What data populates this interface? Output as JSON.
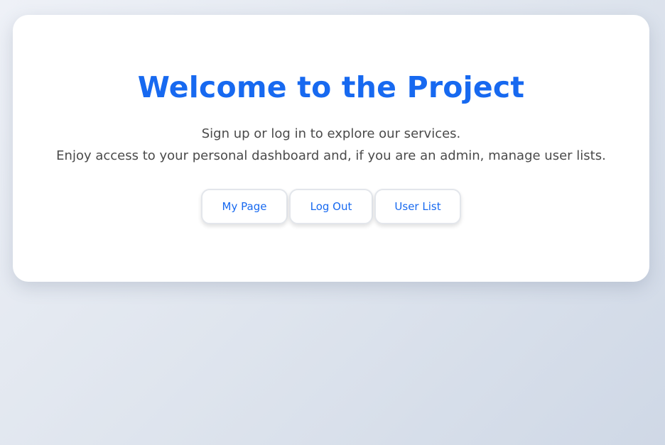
{
  "hero": {
    "title": "Welcome to the Project",
    "description_line1": "Sign up or log in to explore our services.",
    "description_line2": "Enjoy access to your personal dashboard and, if you are an admin, manage user lists."
  },
  "actions": {
    "my_page_label": "My Page",
    "log_out_label": "Log Out",
    "user_list_label": "User List"
  },
  "colors": {
    "accent": "#1769f0",
    "text": "#4a4a4a",
    "card": "#ffffff"
  }
}
